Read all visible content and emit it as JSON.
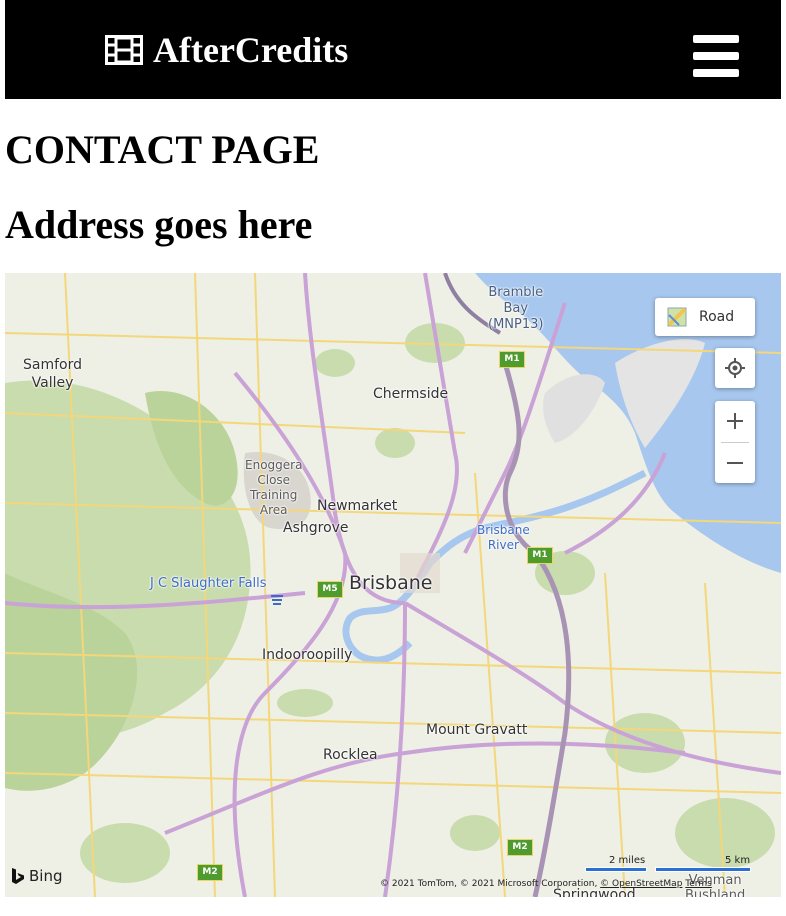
{
  "nav": {
    "brand": "AfterCredits"
  },
  "page": {
    "title": "CONTACT PAGE",
    "address": "Address goes here"
  },
  "map": {
    "places": {
      "samford": "Samford\nValley",
      "bramble": "Bramble\nBay\n(MNP13)",
      "chermside": "Chermside",
      "enoggera": "Enoggera\nClose\nTraining\nArea",
      "newmarket": "Newmarket",
      "ashgrove": "Ashgrove",
      "brisbane_river": "Brisbane\nRiver",
      "jc_falls": "J C Slaughter Falls",
      "brisbane": "Brisbane",
      "indooroopilly": "Indooroopilly",
      "mount_gravatt": "Mount Gravatt",
      "rocklea": "Rocklea",
      "springwood": "Springwood",
      "venman": "Venman\nBushland"
    },
    "shields": {
      "m1_top": "M1",
      "m1_mid": "M1",
      "m5": "M5",
      "m2_bottom": "M2",
      "m2_left": "M2"
    },
    "controls": {
      "map_type": "Road"
    },
    "brand": "Bing",
    "scale": {
      "miles": "2 miles",
      "km": "5 km"
    },
    "credits": {
      "text": "© 2021 TomTom, © 2021 Microsoft Corporation, ",
      "osm": "© OpenStreetMap",
      "terms": "Terms"
    },
    "colors": {
      "water": "#a7c7ef",
      "park": "#c9dcae",
      "major_road": "#c9a2d6",
      "minor_road": "#f3d77a"
    }
  }
}
